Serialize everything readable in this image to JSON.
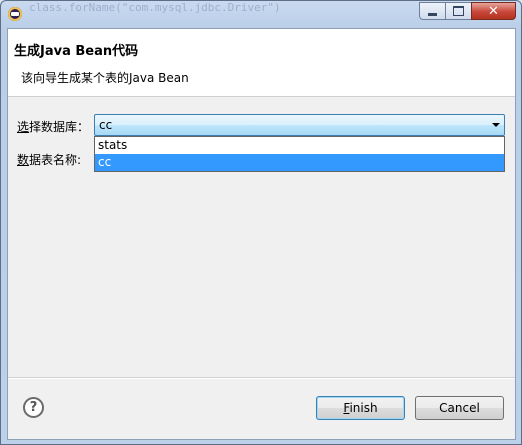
{
  "titlebar": {
    "ghost_text": "class.forName(\"com.mysql.jdbc.Driver\")"
  },
  "header": {
    "title": "生成Java Bean代码",
    "description": "该向导生成某个表的Java Bean"
  },
  "form": {
    "db_label_mnemonic": "选",
    "db_label_rest": "择数据库：",
    "table_label_mnemonic": "数",
    "table_label_rest": "据表名称:",
    "db_combo_value": "cc",
    "db_options": [
      "stats",
      "cc"
    ],
    "db_selected_index": 1
  },
  "footer": {
    "help_glyph": "?",
    "finish_mnemonic": "F",
    "finish_rest": "inish",
    "cancel_label": "Cancel"
  },
  "window_controls": {
    "close_glyph": "✕"
  }
}
